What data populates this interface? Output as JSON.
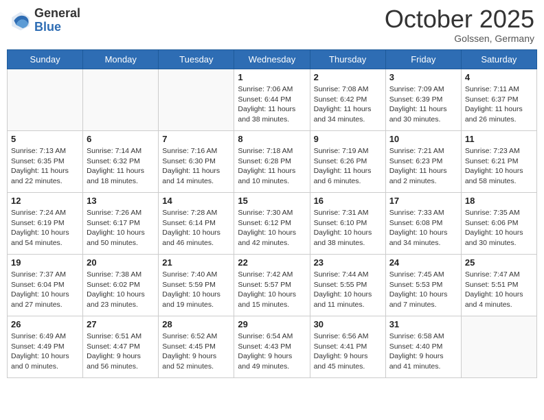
{
  "header": {
    "logo_general": "General",
    "logo_blue": "Blue",
    "month": "October 2025",
    "location": "Golssen, Germany"
  },
  "days_of_week": [
    "Sunday",
    "Monday",
    "Tuesday",
    "Wednesday",
    "Thursday",
    "Friday",
    "Saturday"
  ],
  "weeks": [
    [
      {
        "day": "",
        "info": ""
      },
      {
        "day": "",
        "info": ""
      },
      {
        "day": "",
        "info": ""
      },
      {
        "day": "1",
        "info": "Sunrise: 7:06 AM\nSunset: 6:44 PM\nDaylight: 11 hours and 38 minutes."
      },
      {
        "day": "2",
        "info": "Sunrise: 7:08 AM\nSunset: 6:42 PM\nDaylight: 11 hours and 34 minutes."
      },
      {
        "day": "3",
        "info": "Sunrise: 7:09 AM\nSunset: 6:39 PM\nDaylight: 11 hours and 30 minutes."
      },
      {
        "day": "4",
        "info": "Sunrise: 7:11 AM\nSunset: 6:37 PM\nDaylight: 11 hours and 26 minutes."
      }
    ],
    [
      {
        "day": "5",
        "info": "Sunrise: 7:13 AM\nSunset: 6:35 PM\nDaylight: 11 hours and 22 minutes."
      },
      {
        "day": "6",
        "info": "Sunrise: 7:14 AM\nSunset: 6:32 PM\nDaylight: 11 hours and 18 minutes."
      },
      {
        "day": "7",
        "info": "Sunrise: 7:16 AM\nSunset: 6:30 PM\nDaylight: 11 hours and 14 minutes."
      },
      {
        "day": "8",
        "info": "Sunrise: 7:18 AM\nSunset: 6:28 PM\nDaylight: 11 hours and 10 minutes."
      },
      {
        "day": "9",
        "info": "Sunrise: 7:19 AM\nSunset: 6:26 PM\nDaylight: 11 hours and 6 minutes."
      },
      {
        "day": "10",
        "info": "Sunrise: 7:21 AM\nSunset: 6:23 PM\nDaylight: 11 hours and 2 minutes."
      },
      {
        "day": "11",
        "info": "Sunrise: 7:23 AM\nSunset: 6:21 PM\nDaylight: 10 hours and 58 minutes."
      }
    ],
    [
      {
        "day": "12",
        "info": "Sunrise: 7:24 AM\nSunset: 6:19 PM\nDaylight: 10 hours and 54 minutes."
      },
      {
        "day": "13",
        "info": "Sunrise: 7:26 AM\nSunset: 6:17 PM\nDaylight: 10 hours and 50 minutes."
      },
      {
        "day": "14",
        "info": "Sunrise: 7:28 AM\nSunset: 6:14 PM\nDaylight: 10 hours and 46 minutes."
      },
      {
        "day": "15",
        "info": "Sunrise: 7:30 AM\nSunset: 6:12 PM\nDaylight: 10 hours and 42 minutes."
      },
      {
        "day": "16",
        "info": "Sunrise: 7:31 AM\nSunset: 6:10 PM\nDaylight: 10 hours and 38 minutes."
      },
      {
        "day": "17",
        "info": "Sunrise: 7:33 AM\nSunset: 6:08 PM\nDaylight: 10 hours and 34 minutes."
      },
      {
        "day": "18",
        "info": "Sunrise: 7:35 AM\nSunset: 6:06 PM\nDaylight: 10 hours and 30 minutes."
      }
    ],
    [
      {
        "day": "19",
        "info": "Sunrise: 7:37 AM\nSunset: 6:04 PM\nDaylight: 10 hours and 27 minutes."
      },
      {
        "day": "20",
        "info": "Sunrise: 7:38 AM\nSunset: 6:02 PM\nDaylight: 10 hours and 23 minutes."
      },
      {
        "day": "21",
        "info": "Sunrise: 7:40 AM\nSunset: 5:59 PM\nDaylight: 10 hours and 19 minutes."
      },
      {
        "day": "22",
        "info": "Sunrise: 7:42 AM\nSunset: 5:57 PM\nDaylight: 10 hours and 15 minutes."
      },
      {
        "day": "23",
        "info": "Sunrise: 7:44 AM\nSunset: 5:55 PM\nDaylight: 10 hours and 11 minutes."
      },
      {
        "day": "24",
        "info": "Sunrise: 7:45 AM\nSunset: 5:53 PM\nDaylight: 10 hours and 7 minutes."
      },
      {
        "day": "25",
        "info": "Sunrise: 7:47 AM\nSunset: 5:51 PM\nDaylight: 10 hours and 4 minutes."
      }
    ],
    [
      {
        "day": "26",
        "info": "Sunrise: 6:49 AM\nSunset: 4:49 PM\nDaylight: 10 hours and 0 minutes."
      },
      {
        "day": "27",
        "info": "Sunrise: 6:51 AM\nSunset: 4:47 PM\nDaylight: 9 hours and 56 minutes."
      },
      {
        "day": "28",
        "info": "Sunrise: 6:52 AM\nSunset: 4:45 PM\nDaylight: 9 hours and 52 minutes."
      },
      {
        "day": "29",
        "info": "Sunrise: 6:54 AM\nSunset: 4:43 PM\nDaylight: 9 hours and 49 minutes."
      },
      {
        "day": "30",
        "info": "Sunrise: 6:56 AM\nSunset: 4:41 PM\nDaylight: 9 hours and 45 minutes."
      },
      {
        "day": "31",
        "info": "Sunrise: 6:58 AM\nSunset: 4:40 PM\nDaylight: 9 hours and 41 minutes."
      },
      {
        "day": "",
        "info": ""
      }
    ]
  ]
}
